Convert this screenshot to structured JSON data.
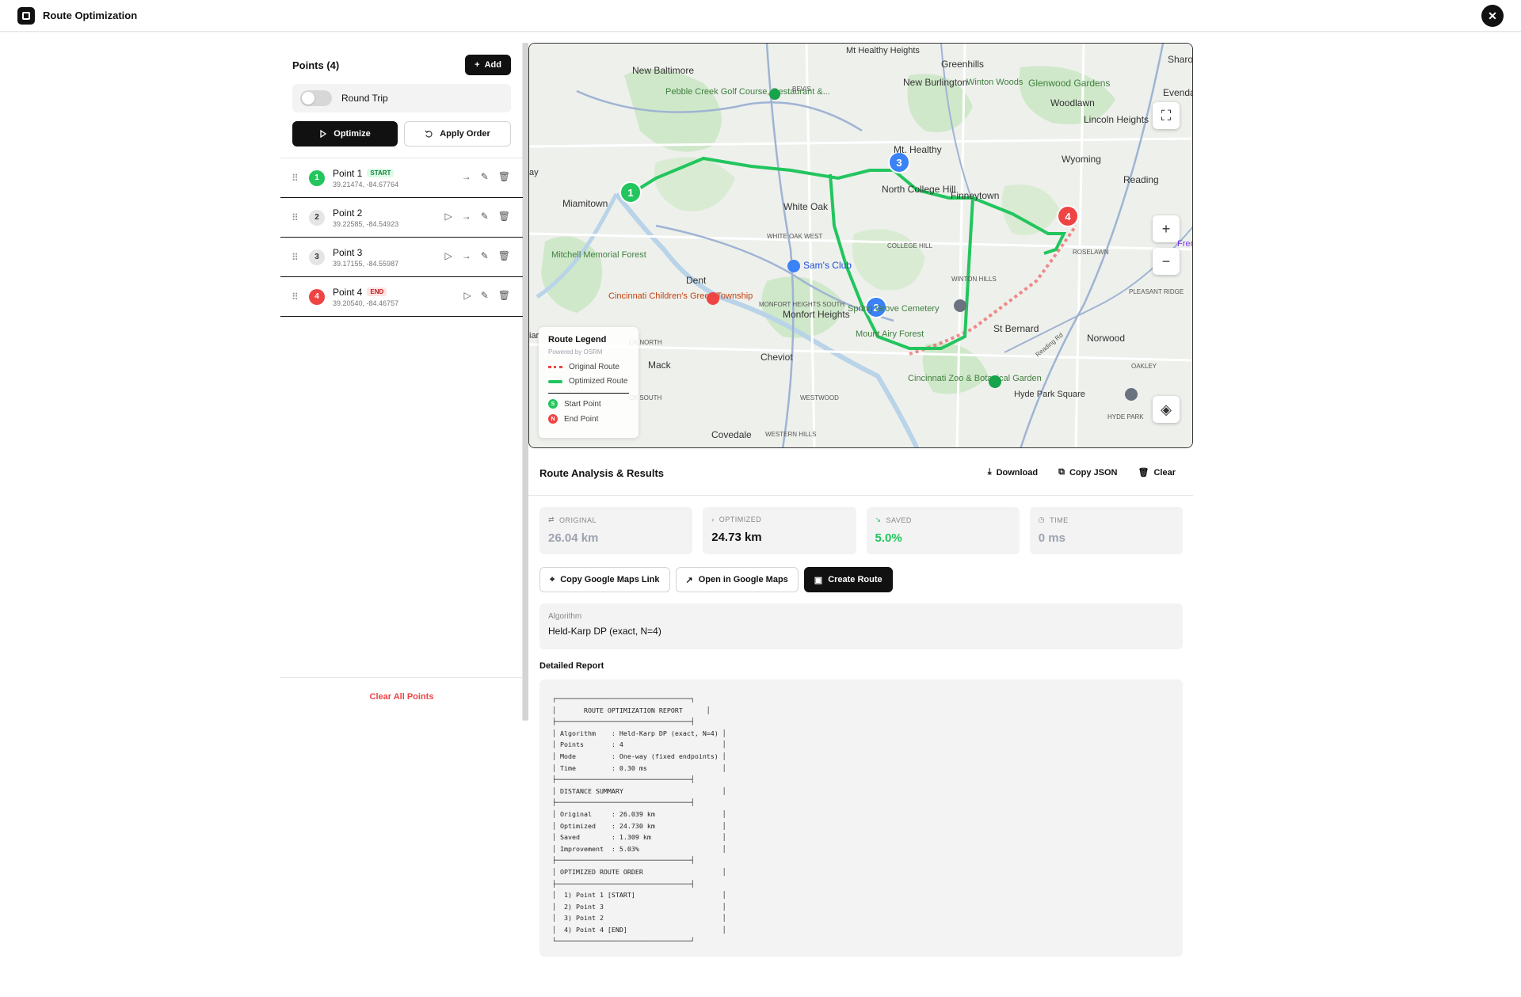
{
  "window": {
    "title": "Route Optimization",
    "close_icon": "close-icon"
  },
  "left": {
    "points_title": "Points (4)",
    "add_label": "Add",
    "round_trip_label": "Round Trip",
    "round_trip_on": false,
    "optimize_label": "Optimize",
    "apply_order_label": "Apply Order",
    "points": [
      {
        "num": "1",
        "name": "Point 1",
        "tag": "START",
        "coords": "39.21474, -84.67764"
      },
      {
        "num": "2",
        "name": "Point 2",
        "tag": "",
        "coords": "39.22585, -84.54923"
      },
      {
        "num": "3",
        "name": "Point 3",
        "tag": "",
        "coords": "39.17155, -84.55987"
      },
      {
        "num": "4",
        "name": "Point 4",
        "tag": "END",
        "coords": "39.20540, -84.46757"
      }
    ],
    "clear_all_label": "Clear All Points"
  },
  "map": {
    "place_labels": [
      "New Baltimore",
      "Mt Healthy Heights",
      "Greenhills",
      "New Burlington",
      "Winton Woods",
      "Glenwood Gardens",
      "Woodlawn",
      "Lincoln Heights",
      "Pebble Creek Golf Course, Restaurant &...",
      "Mt. Healthy",
      "Wyoming",
      "Reading",
      "North College Hill",
      "Finneytown",
      "Miamitown",
      "White Oak",
      "WHITE OAK WEST",
      "Sam's Club",
      "COLLEGE HILL",
      "ROSELAWN",
      "PLEASANT RIDGE",
      "Mitchell Memorial Forest",
      "Dent",
      "Cincinnati Children's Green Township",
      "MONFORT HEIGHTS SOUTH",
      "Monfort Heights",
      "WINTON HILLS",
      "Spring Grove Cemetery",
      "St Bernard",
      "Mount Airy Forest",
      "Norwood",
      "Mack",
      "Cheviot",
      "OAKLEY",
      "Cincinnati Zoo & Botanical Garden",
      "Hyde Park Square",
      "HYDE PARK",
      "WESTWOOD",
      "Covedale",
      "WESTERN HILLS",
      "BEVIS",
      "CK NORTH",
      "CK SOUTH",
      "Sharo",
      "Evenda",
      "Fren",
      "ay",
      "iar",
      "Reading Rd"
    ],
    "legend": {
      "title": "Route Legend",
      "subtitle": "Powered by OSRM",
      "original": "Original Route",
      "optimized": "Optimized Route",
      "start": "Start Point",
      "end": "End Point",
      "start_badge": "S",
      "end_badge": "N"
    },
    "markers": [
      "1",
      "2",
      "3",
      "4"
    ],
    "zoom_in": "+",
    "zoom_out": "−",
    "route_colors": {
      "optimized": "#22c55e",
      "original": "#ef4444",
      "start": "#22c55e",
      "mid": "#3b82f6",
      "end": "#ef4444"
    }
  },
  "results": {
    "title": "Route Analysis & Results",
    "download_label": "Download",
    "copy_json_label": "Copy JSON",
    "clear_label": "Clear",
    "stats": [
      {
        "label": "ORIGINAL",
        "value": "26.04 km",
        "color": "#9ca3af",
        "icon": "route-icon"
      },
      {
        "label": "OPTIMIZED",
        "value": "24.73 km",
        "color": "#111111",
        "icon": "chevron-right-icon"
      },
      {
        "label": "SAVED",
        "value": "5.0%",
        "color": "#22c55e",
        "icon": "trending-down-icon"
      },
      {
        "label": "TIME",
        "value": "0 ms",
        "color": "#9ca3af",
        "icon": "clock-icon"
      }
    ],
    "copy_gmaps_label": "Copy Google Maps Link",
    "open_gmaps_label": "Open in Google Maps",
    "create_route_label": "Create Route",
    "algorithm_label": "Algorithm",
    "algorithm_value": "Held-Karp DP (exact, N=4)",
    "detailed_report_label": "Detailed Report",
    "report_text": "┌──────────────────────────────────┐\n│       ROUTE OPTIMIZATION REPORT      │\n├──────────────────────────────────┤\n│ Algorithm    : Held-Karp DP (exact, N=4) │\n│ Points       : 4                         │\n│ Mode         : One-way (fixed endpoints) │\n│ Time         : 0.30 ms                   │\n├──────────────────────────────────┤\n│ DISTANCE SUMMARY                         │\n├──────────────────────────────────┤\n│ Original     : 26.039 km                 │\n│ Optimized    : 24.730 km                 │\n│ Saved        : 1.309 km                  │\n│ Improvement  : 5.03%                     │\n├──────────────────────────────────┤\n│ OPTIMIZED ROUTE ORDER                    │\n├──────────────────────────────────┤\n│  1) Point 1 [START]                      │\n│  2) Point 3                              │\n│  3) Point 2                              │\n│  4) Point 4 [END]                        │\n└──────────────────────────────────┘"
  }
}
